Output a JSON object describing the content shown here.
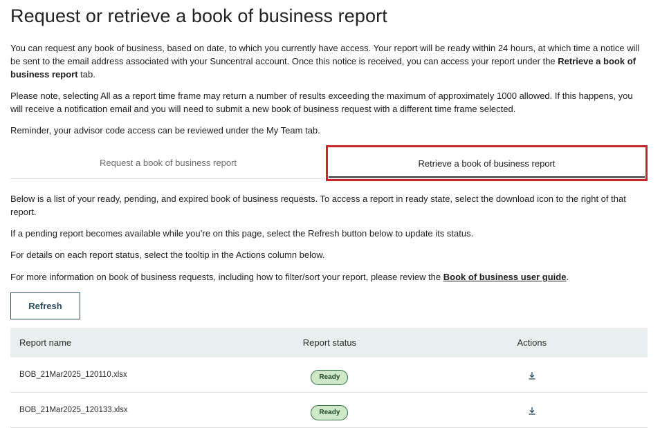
{
  "page": {
    "title": "Request or retrieve a book of business report",
    "intro": {
      "p1_text": "You can request any book of business, based on date, to which you currently have access. Your report will be ready within 24 hours, at which time a notice will be sent to the email address associated with your Suncentral account. Once this notice is received, you can access your report under the ",
      "p1_bold": "Retrieve a book of business report",
      "p1_end": " tab.",
      "p2": "Please note, selecting All as a report time frame may return a number of results exceeding the maximum of approximately 1000 allowed. If this happens, you will receive a notification email and you will need to submit a new book of business request with a different time frame selected.",
      "p3": "Reminder, your advisor code access can be reviewed under the My Team tab."
    }
  },
  "tabs": [
    {
      "label": "Request a book of business report",
      "active": false
    },
    {
      "label": "Retrieve a book of business report",
      "active": true
    }
  ],
  "retrieve": {
    "p1": "Below is a list of your ready, pending, and expired book of business requests. To access a report in ready state, select the download icon to the right of that report.",
    "p2": "If a pending report becomes available while you’re on this page, select the Refresh button below to update its status.",
    "p3": "For details on each report status, select the tooltip in the Actions column below.",
    "p4_text": "For more information on book of business requests, including how to filter/sort your report, please review the ",
    "p4_link": "Book of business user guide",
    "p4_end": ".",
    "refresh_label": "Refresh"
  },
  "table": {
    "headers": [
      "Report name",
      "Report status",
      "Actions"
    ],
    "rows": [
      {
        "name": "BOB_21Mar2025_120110.xlsx",
        "status": "Ready",
        "action_icon": "download-icon"
      },
      {
        "name": "BOB_21Mar2025_120133.xlsx",
        "status": "Ready",
        "action_icon": "download-icon"
      }
    ]
  },
  "colors": {
    "highlight_border": "#c8262c",
    "button_text": "#2a4a5e",
    "table_header_bg": "#e8efee",
    "badge_bg": "#cfe9c8",
    "badge_border": "#2f6b3f"
  }
}
